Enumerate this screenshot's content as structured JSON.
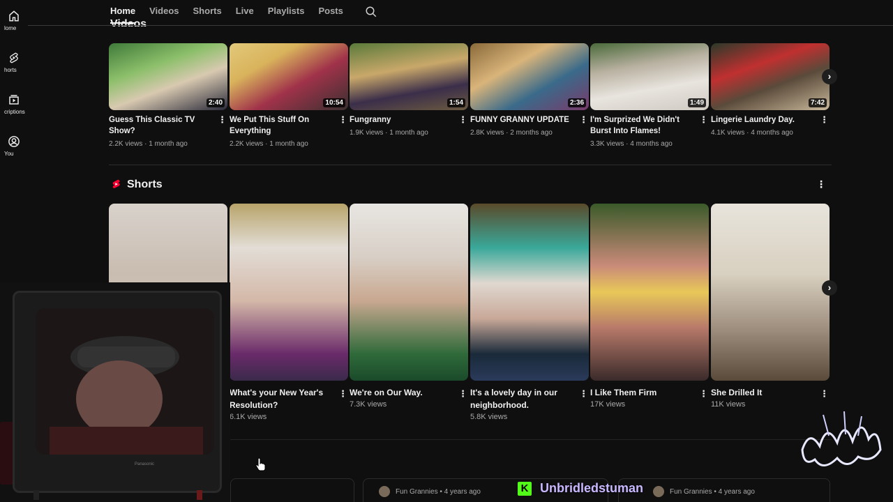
{
  "guide": {
    "items": [
      {
        "label": "Home",
        "icon": "home-icon"
      },
      {
        "label": "Shorts",
        "icon": "shorts-icon"
      },
      {
        "label": "Subscriptions",
        "icon": "subscriptions-icon"
      },
      {
        "label": "You",
        "icon": "you-icon"
      }
    ],
    "visible_labels": [
      "lome",
      "horts",
      "criptions",
      "You"
    ]
  },
  "tabs": [
    "Home",
    "Videos",
    "Shorts",
    "Live",
    "Playlists",
    "Posts"
  ],
  "active_tab": "Home",
  "videos_heading": "Videos",
  "videos": [
    {
      "title": "Guess This Classic TV Show?",
      "duration": "2:40",
      "views": "2.2K views",
      "age": "1 month ago"
    },
    {
      "title": "We Put This Stuff On Everything",
      "duration": "10:54",
      "views": "2.2K views",
      "age": "1 month ago"
    },
    {
      "title": "Fungranny",
      "duration": "1:54",
      "views": "1.9K views",
      "age": "1 month ago"
    },
    {
      "title": "FUNNY GRANNY UPDATE",
      "duration": "2:36",
      "views": "2.8K views",
      "age": "2 months ago"
    },
    {
      "title": "I'm Surprized We Didn't Burst Into Flames!",
      "duration": "1:49",
      "views": "3.3K views",
      "age": "4 months ago"
    },
    {
      "title": "Lingerie Laundry Day.",
      "duration": "7:42",
      "views": "4.1K views",
      "age": "4 months ago"
    }
  ],
  "shorts_heading": "Shorts",
  "shorts": [
    {
      "title": "",
      "views": ""
    },
    {
      "title": "What's your New Year's Resolution?",
      "views": "6.1K views"
    },
    {
      "title": "We're  on Our Way.",
      "views": "7.3K views"
    },
    {
      "title": "It's a lovely day in our neighborhood.",
      "views": "5.8K views"
    },
    {
      "title": "I Like Them Firm",
      "views": "17K views"
    },
    {
      "title": "She Drilled It",
      "views": "11K views"
    }
  ],
  "posts": [
    {
      "author": "Fun Grannies",
      "age": "4 years ago"
    },
    {
      "author": "Fun Grannies",
      "age": "4 years ago"
    }
  ],
  "overlay": {
    "streamer_name": "Unbridledstuman",
    "platform_badge": "K",
    "tv_brand": "Panasonic"
  },
  "colors": {
    "background": "#0f0f0f",
    "text_primary": "#f1f1f1",
    "text_secondary": "#aaaaaa",
    "shorts_red": "#ff0033",
    "kick_green": "#53fc18"
  }
}
